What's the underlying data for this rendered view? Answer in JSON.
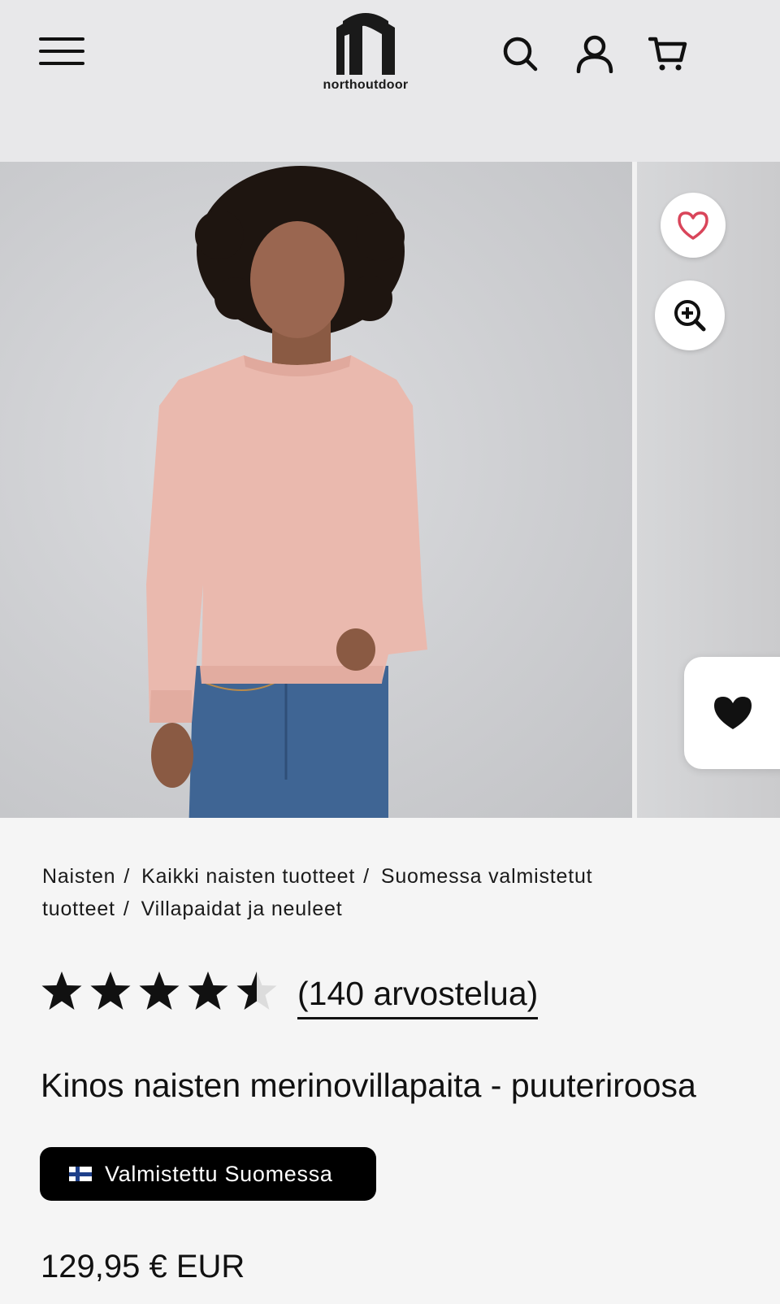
{
  "header": {
    "brand": "northoutdoor",
    "icons": [
      "menu-icon",
      "search-icon",
      "account-icon",
      "cart-icon"
    ]
  },
  "gallery": {
    "photo_alt": "Woman wearing pink merino sweater and blue jeans",
    "wishlist_icon": "heart-outline-icon",
    "zoom_icon": "zoom-in-icon",
    "floating_icon": "heart-filled-icon"
  },
  "breadcrumb": [
    {
      "label": "Naisten"
    },
    {
      "label": "Kaikki naisten tuotteet"
    },
    {
      "label": "Suomessa valmistetut tuotteet"
    },
    {
      "label": "Villapaidat ja neuleet"
    }
  ],
  "rating": {
    "value": 4.5,
    "max": 5,
    "reviews_label": "(140 arvostelua)"
  },
  "product": {
    "title": "Kinos naisten merinovillapaita - puuteriroosa",
    "badge": "Valmistettu Suomessa",
    "price": "129,95 € EUR"
  },
  "colors": {
    "header_bg": "#e8e8ea",
    "page_bg": "#f5f5f5",
    "badge_bg": "#000000",
    "sweater": "#eab9ae",
    "jeans": "#3f6594",
    "heart_outline": "#d9455a"
  }
}
